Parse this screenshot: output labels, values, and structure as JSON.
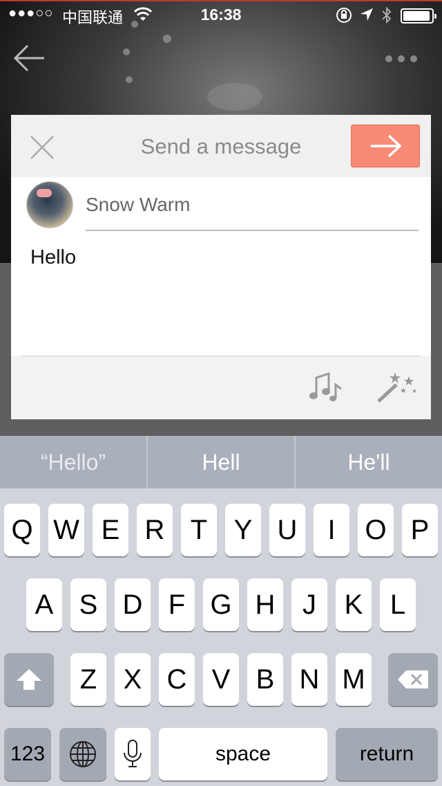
{
  "status_bar": {
    "signal": "●●●○○",
    "carrier": "中国联通",
    "time": "16:38",
    "battery_level": 0.95
  },
  "dialog": {
    "title": "Send a message",
    "recipient": "Snow Warm",
    "message": "Hello"
  },
  "predictions": [
    "“Hello”",
    "Hell",
    "He'll"
  ],
  "keyboard": {
    "row1": [
      "Q",
      "W",
      "E",
      "R",
      "T",
      "Y",
      "U",
      "I",
      "O",
      "P"
    ],
    "row2": [
      "A",
      "S",
      "D",
      "F",
      "G",
      "H",
      "J",
      "K",
      "L"
    ],
    "row3": [
      "Z",
      "X",
      "C",
      "V",
      "B",
      "N",
      "M"
    ],
    "numbers_label": "123",
    "space_label": "space",
    "return_label": "return"
  },
  "colors": {
    "send_button": "#f88a76",
    "keyboard_bg": "#d1d5db",
    "predictive_bar": "#a9b0bb"
  }
}
